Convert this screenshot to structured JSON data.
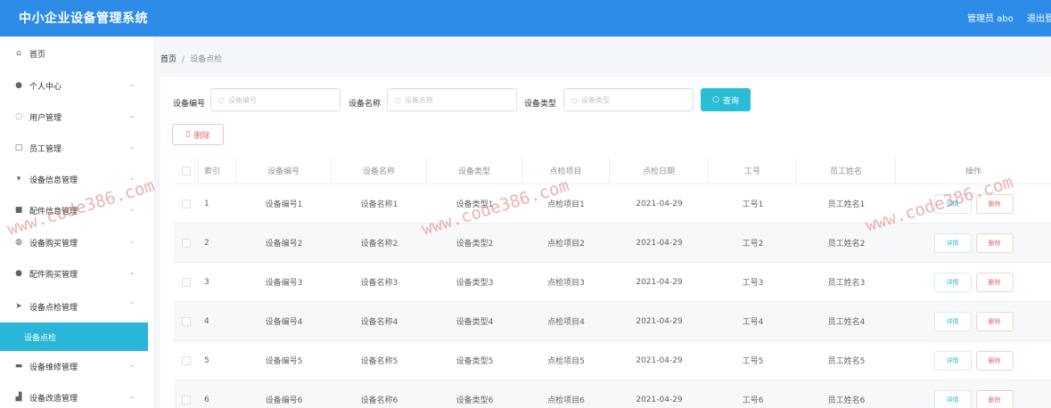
{
  "header": {
    "title": "中小企业设备管理系统",
    "user": "管理员 abo",
    "logout": "退出登录"
  },
  "sidebar": {
    "items": [
      {
        "label": "首页",
        "icon": "home-icon"
      },
      {
        "label": "个人中心",
        "icon": "user-icon"
      },
      {
        "label": "用户管理",
        "icon": "users-icon"
      },
      {
        "label": "员工管理",
        "icon": "employee-icon"
      },
      {
        "label": "设备信息管理",
        "icon": "device-icon"
      },
      {
        "label": "配件信息管理",
        "icon": "parts-icon"
      },
      {
        "label": "设备购买管理",
        "icon": "cart-icon"
      },
      {
        "label": "配件购买管理",
        "icon": "location-icon"
      },
      {
        "label": "设备点检管理",
        "icon": "send-icon"
      },
      {
        "label": "设备维修管理",
        "icon": "monitor-icon"
      },
      {
        "label": "设备改造管理",
        "icon": "tools-icon"
      }
    ],
    "active_sub": "设备点检"
  },
  "breadcrumb": {
    "home": "首页",
    "sep": "/",
    "current": "设备点检"
  },
  "search": {
    "field1_label": "设备编号",
    "field1_placeholder": "设备编号",
    "field2_label": "设备名称",
    "field2_placeholder": "设备名称",
    "field3_label": "设备类型",
    "field3_placeholder": "设备类型",
    "query_button": "查询"
  },
  "toolbar": {
    "delete_button": "删除"
  },
  "table": {
    "columns": [
      "索引",
      "设备编号",
      "设备名称",
      "设备类型",
      "点检项目",
      "点检日期",
      "工号",
      "员工姓名",
      "操作"
    ],
    "rows": [
      [
        "1",
        "设备编号1",
        "设备名称1",
        "设备类型1",
        "点检项目1",
        "2021-04-29",
        "工号1",
        "员工姓名1"
      ],
      [
        "2",
        "设备编号2",
        "设备名称2",
        "设备类型2",
        "点检项目2",
        "2021-04-29",
        "工号2",
        "员工姓名2"
      ],
      [
        "3",
        "设备编号3",
        "设备名称3",
        "设备类型3",
        "点检项目3",
        "2021-04-29",
        "工号3",
        "员工姓名3"
      ],
      [
        "4",
        "设备编号4",
        "设备名称4",
        "设备类型4",
        "点检项目4",
        "2021-04-29",
        "工号4",
        "员工姓名4"
      ],
      [
        "5",
        "设备编号5",
        "设备名称5",
        "设备类型5",
        "点检项目5",
        "2021-04-29",
        "工号5",
        "员工姓名5"
      ],
      [
        "6",
        "设备编号6",
        "设备名称6",
        "设备类型6",
        "点检项目6",
        "2021-04-29",
        "工号6",
        "员工姓名6"
      ]
    ],
    "action_detail": "详情",
    "action_delete": "删除"
  },
  "watermark": "www.code386.com",
  "colors": {
    "header": "#2d8ce7",
    "accent": "#2abdd6",
    "danger": "#e26c6c"
  }
}
